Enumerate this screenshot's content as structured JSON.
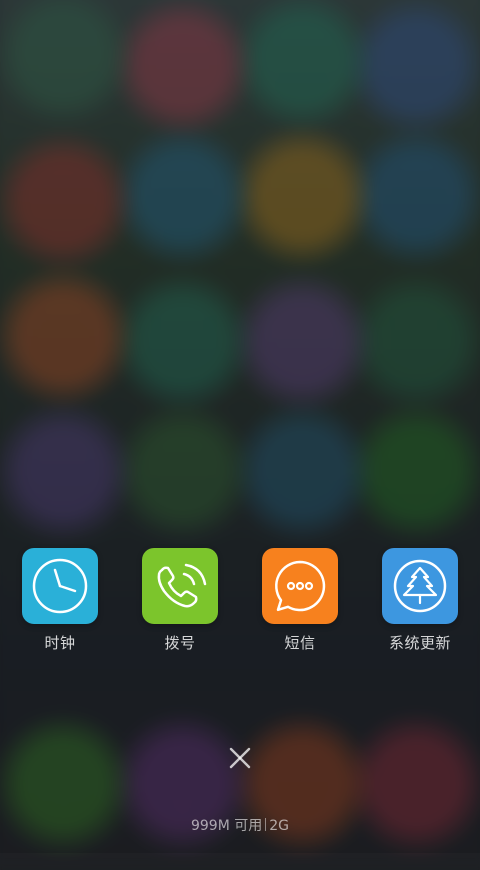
{
  "recent_apps": [
    {
      "label": "时钟",
      "icon": "clock-icon",
      "color": "#2ab0d8"
    },
    {
      "label": "拨号",
      "icon": "phone-icon",
      "color": "#7cc52c"
    },
    {
      "label": "短信",
      "icon": "message-icon",
      "color": "#f7811e"
    },
    {
      "label": "系统更新",
      "icon": "system-update-icon",
      "color": "#3d97e0"
    }
  ],
  "close_all_icon": "close-icon",
  "memory_status": {
    "available": "999M 可用",
    "total": "2G"
  }
}
